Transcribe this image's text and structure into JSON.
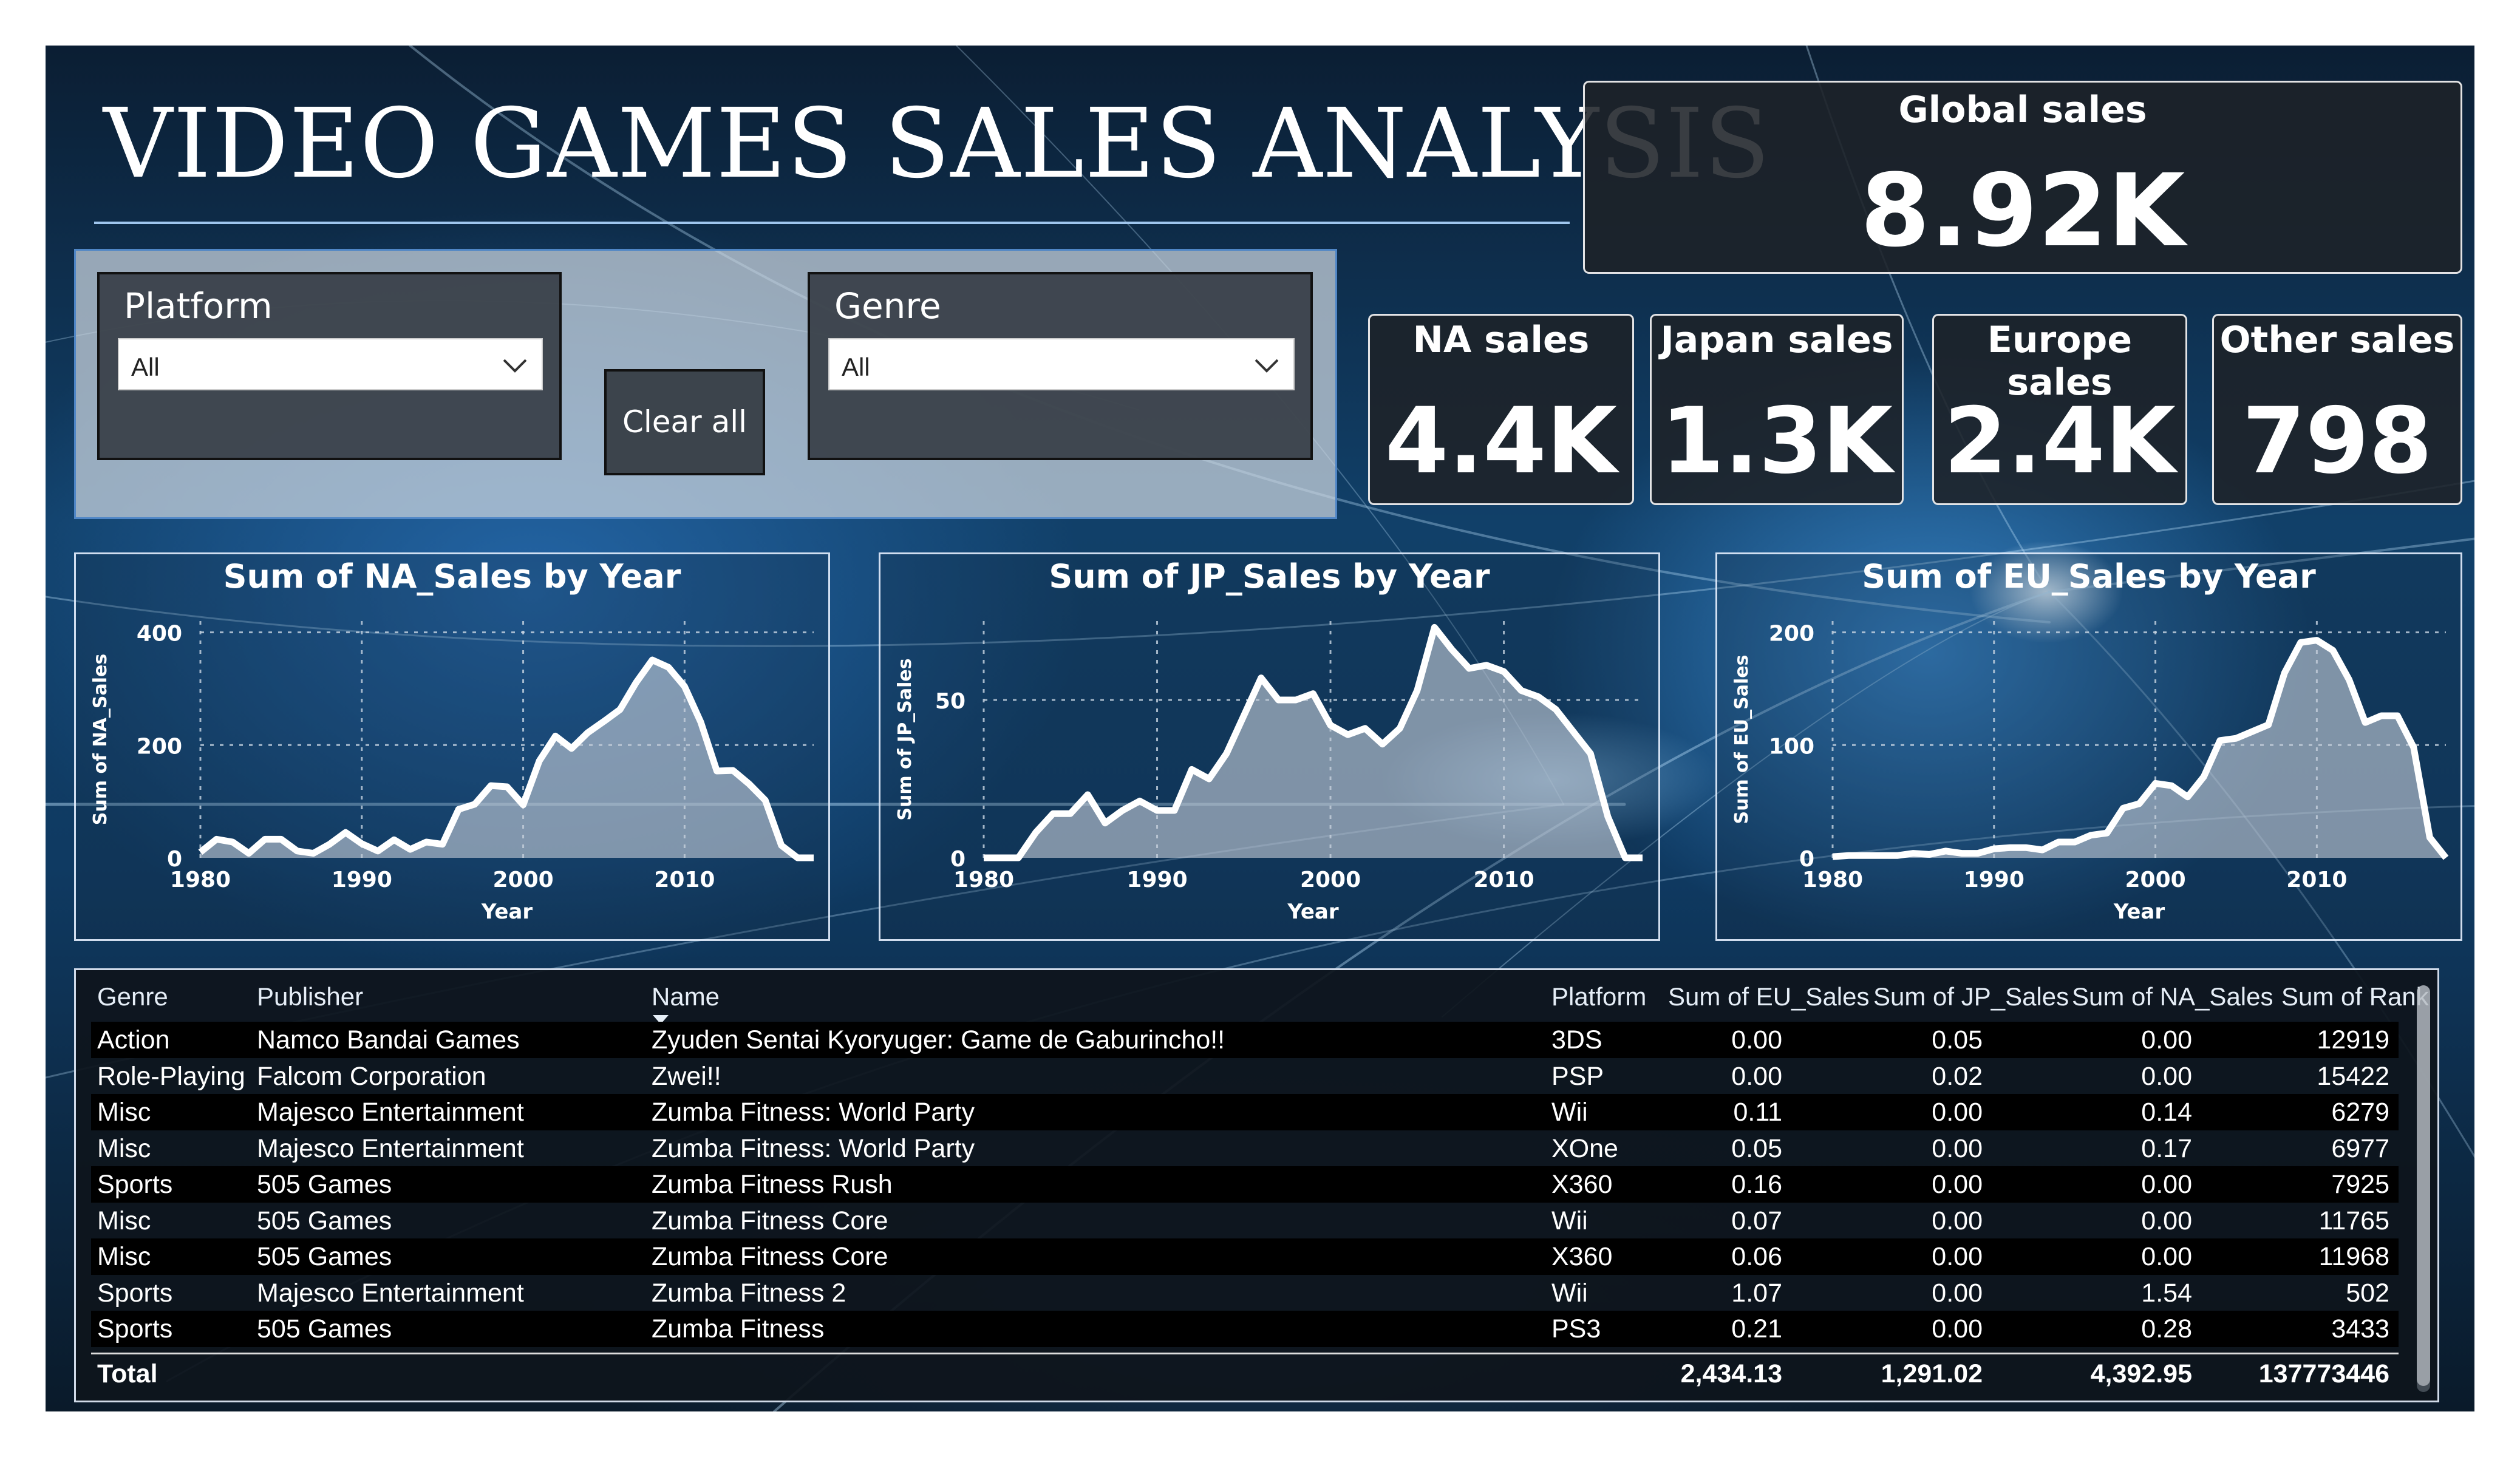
{
  "title": "VIDEO GAMES SALES ANALYSIS",
  "global": {
    "label": "Global sales",
    "value": "8.92K"
  },
  "kpis": [
    {
      "label": "NA sales",
      "value": "4.4K"
    },
    {
      "label": "Japan sales",
      "value": "1.3K"
    },
    {
      "label": "Europe sales",
      "value": "2.4K"
    },
    {
      "label": "Other sales",
      "value": "798"
    }
  ],
  "slicers": {
    "platform": {
      "label": "Platform",
      "value": "All"
    },
    "genre": {
      "label": "Genre",
      "value": "All"
    },
    "clear_label": "Clear all"
  },
  "chart_data": [
    {
      "type": "area",
      "title": "Sum of NA_Sales by Year",
      "xlabel": "Year",
      "ylabel": "Sum of NA_Sales",
      "xlim": [
        1980,
        2018
      ],
      "ylim": [
        0,
        420
      ],
      "xticks": [
        1980,
        1990,
        2000,
        2010
      ],
      "yticks": [
        0,
        200,
        400
      ],
      "x": [
        1980,
        1981,
        1982,
        1983,
        1984,
        1985,
        1986,
        1987,
        1988,
        1989,
        1990,
        1991,
        1992,
        1993,
        1994,
        1995,
        1996,
        1997,
        1998,
        1999,
        2000,
        2001,
        2002,
        2003,
        2004,
        2005,
        2006,
        2007,
        2008,
        2009,
        2010,
        2011,
        2012,
        2013,
        2014,
        2015,
        2016,
        2017,
        2018
      ],
      "values": [
        10,
        33,
        28,
        8,
        33,
        33,
        12,
        8,
        24,
        45,
        25,
        12,
        32,
        15,
        28,
        24,
        86,
        95,
        128,
        126,
        94,
        172,
        216,
        194,
        222,
        242,
        263,
        311,
        351,
        338,
        304,
        241,
        154,
        155,
        131,
        102,
        22,
        0,
        0
      ]
    },
    {
      "type": "area",
      "title": "Sum of JP_Sales by Year",
      "xlabel": "Year",
      "ylabel": "Sum of JP_Sales",
      "xlim": [
        1980,
        2018
      ],
      "ylim": [
        0,
        75
      ],
      "xticks": [
        1980,
        1990,
        2000,
        2010
      ],
      "yticks": [
        0,
        50
      ],
      "x": [
        1980,
        1981,
        1982,
        1983,
        1984,
        1985,
        1986,
        1987,
        1988,
        1989,
        1990,
        1991,
        1992,
        1993,
        1994,
        1995,
        1996,
        1997,
        1998,
        1999,
        2000,
        2001,
        2002,
        2003,
        2004,
        2005,
        2006,
        2007,
        2008,
        2009,
        2010,
        2011,
        2012,
        2013,
        2014,
        2015,
        2016,
        2017,
        2018
      ],
      "values": [
        0,
        0,
        0,
        8,
        14,
        14,
        20,
        11,
        15,
        18,
        15,
        15,
        28,
        25,
        33,
        45,
        57,
        50,
        50,
        52,
        42,
        39,
        41,
        36,
        41,
        53,
        73,
        66,
        60,
        61,
        59,
        53,
        51,
        47,
        40,
        33,
        13,
        0,
        0
      ]
    },
    {
      "type": "area",
      "title": "Sum of EU_Sales by Year",
      "xlabel": "Year",
      "ylabel": "Sum of EU_Sales",
      "xlim": [
        1980,
        2018
      ],
      "ylim": [
        0,
        210
      ],
      "xticks": [
        1980,
        1990,
        2000,
        2010
      ],
      "yticks": [
        0,
        100,
        200
      ],
      "x": [
        1980,
        1981,
        1982,
        1983,
        1984,
        1985,
        1986,
        1987,
        1988,
        1989,
        1990,
        1991,
        1992,
        1993,
        1994,
        1995,
        1996,
        1997,
        1998,
        1999,
        2000,
        2001,
        2002,
        2003,
        2004,
        2005,
        2006,
        2007,
        2008,
        2009,
        2010,
        2011,
        2012,
        2013,
        2014,
        2015,
        2016,
        2017,
        2018
      ],
      "values": [
        1,
        2,
        2,
        2,
        2,
        4,
        3,
        6,
        4,
        4,
        8,
        9,
        9,
        7,
        14,
        14,
        20,
        22,
        44,
        48,
        66,
        64,
        54,
        72,
        104,
        106,
        112,
        118,
        164,
        191,
        193,
        184,
        158,
        120,
        126,
        126,
        98,
        18,
        0
      ]
    }
  ],
  "table": {
    "headers": [
      "Genre",
      "Publisher",
      "Name",
      "Platform",
      "Sum of EU_Sales",
      "Sum of JP_Sales",
      "Sum of NA_Sales",
      "Sum of Rank"
    ],
    "rows": [
      [
        "Action",
        "Namco Bandai Games",
        "Zyuden Sentai Kyoryuger: Game de Gaburincho!!",
        "3DS",
        "0.00",
        "0.05",
        "0.00",
        "12919"
      ],
      [
        "Role-Playing",
        "Falcom Corporation",
        "Zwei!!",
        "PSP",
        "0.00",
        "0.02",
        "0.00",
        "15422"
      ],
      [
        "Misc",
        "Majesco Entertainment",
        "Zumba Fitness: World Party",
        "Wii",
        "0.11",
        "0.00",
        "0.14",
        "6279"
      ],
      [
        "Misc",
        "Majesco Entertainment",
        "Zumba Fitness: World Party",
        "XOne",
        "0.05",
        "0.00",
        "0.17",
        "6977"
      ],
      [
        "Sports",
        "505 Games",
        "Zumba Fitness Rush",
        "X360",
        "0.16",
        "0.00",
        "0.00",
        "7925"
      ],
      [
        "Misc",
        "505 Games",
        "Zumba Fitness Core",
        "Wii",
        "0.07",
        "0.00",
        "0.00",
        "11765"
      ],
      [
        "Misc",
        "505 Games",
        "Zumba Fitness Core",
        "X360",
        "0.06",
        "0.00",
        "0.00",
        "11968"
      ],
      [
        "Sports",
        "Majesco Entertainment",
        "Zumba Fitness 2",
        "Wii",
        "1.07",
        "0.00",
        "1.54",
        "502"
      ],
      [
        "Sports",
        "505 Games",
        "Zumba Fitness",
        "PS3",
        "0.21",
        "0.00",
        "0.28",
        "3433"
      ]
    ],
    "total": {
      "label": "Total",
      "eu": "2,434.13",
      "jp": "1,291.02",
      "na": "4,392.95",
      "rank": "137773446"
    }
  }
}
